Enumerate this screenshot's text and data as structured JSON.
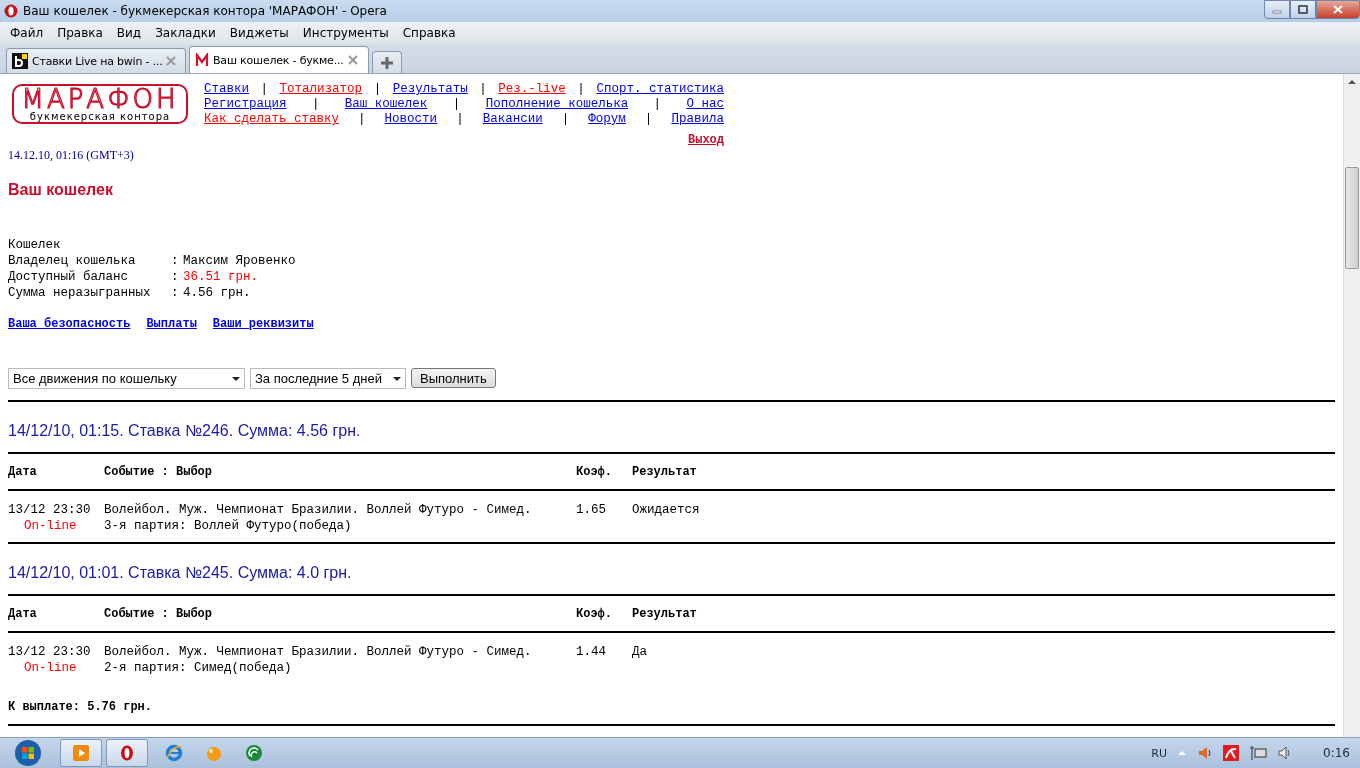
{
  "window": {
    "title": "Ваш кошелек - букмекерская контора 'МАРАФОН' - Opera"
  },
  "menu": [
    "Файл",
    "Правка",
    "Вид",
    "Закладки",
    "Виджеты",
    "Инструменты",
    "Справка"
  ],
  "tabs": [
    {
      "label": "Ставки Live на bwin - ...",
      "selected": false,
      "kind": "bwin"
    },
    {
      "label": "Ваш кошелек - букме...",
      "selected": true,
      "kind": "marathon"
    }
  ],
  "logo": {
    "name": "МАРАФОН",
    "subtitle": "букмекерская контора"
  },
  "nav_rows": [
    [
      {
        "kind": "link",
        "text": "Ставки",
        "color": "#0000ee"
      },
      {
        "kind": "separator",
        "text": "|"
      },
      {
        "kind": "link",
        "text": "Тотализатор",
        "color": "#ff0000"
      },
      {
        "kind": "separator",
        "text": "|"
      },
      {
        "kind": "link",
        "text": "Результаты",
        "color": "#0000ee"
      },
      {
        "kind": "separator",
        "text": "|"
      },
      {
        "kind": "link",
        "text": "Рез.-live",
        "color": "#ff0000"
      },
      {
        "kind": "separator",
        "text": "|"
      },
      {
        "kind": "link",
        "text": "Спорт. статистика",
        "color": "#0000ee"
      }
    ],
    [
      {
        "kind": "link",
        "text": "Регистрация",
        "color": "#0000ee"
      },
      {
        "kind": "separator",
        "text": "|"
      },
      {
        "kind": "link",
        "text": "Ваш кошелек",
        "color": "#0000ee"
      },
      {
        "kind": "separator",
        "text": "|"
      },
      {
        "kind": "link",
        "text": "Пополнение кошелька",
        "color": "#0000ee"
      },
      {
        "kind": "separator",
        "text": "|"
      },
      {
        "kind": "link",
        "text": "О нас",
        "color": "#0000ee"
      }
    ],
    [
      {
        "kind": "link",
        "text": "Как сделать ставку",
        "color": "#ff0000"
      },
      {
        "kind": "separator",
        "text": "|"
      },
      {
        "kind": "link",
        "text": "Новости",
        "color": "#0000ee"
      },
      {
        "kind": "separator",
        "text": "|"
      },
      {
        "kind": "link",
        "text": "Вакансии",
        "color": "#0000ee"
      },
      {
        "kind": "separator",
        "text": "|"
      },
      {
        "kind": "link",
        "text": "Форум",
        "color": "#0000ee"
      },
      {
        "kind": "separator",
        "text": "|"
      },
      {
        "kind": "link",
        "text": "Правила",
        "color": "#0000ee"
      }
    ]
  ],
  "logout": "Выход",
  "datetime": "14.12.10, 01:16 (GMT+3)",
  "heading": "Ваш кошелек",
  "wallet": {
    "title": "Кошелек",
    "fields": [
      {
        "label": "Владелец кошелька",
        "separator": ":",
        "value": "Максим Яровенко",
        "color": "#000000"
      },
      {
        "label": "Доступный баланс",
        "separator": ":",
        "value": "36.51 грн.",
        "color": "#ff0000"
      },
      {
        "label": "Сумма неразыгранных",
        "separator": ":",
        "value": "4.56 грн.",
        "color": "#000000"
      }
    ]
  },
  "links": [
    "Ваша безопасность",
    "Выплаты",
    "Ваши реквизиты"
  ],
  "filters": {
    "type_select": "Все движения по кошельку",
    "period_select": "За последние 5 дней",
    "submit": "Выполнить"
  },
  "bets": [
    {
      "heading": "14/12/10, 01:15. Ставка №246. Сумма: 4.56 грн.",
      "columns": [
        "Дата",
        "Событие : Выбор",
        "Коэф.",
        "Результат"
      ],
      "rows": [
        {
          "date": "13/12 23:30",
          "event": "Волейбол. Муж. Чемпионат Бразилии. Воллей Футуро - Симед.",
          "coef": "1.65",
          "result": "Ожидается",
          "mode": "On-line",
          "selection": "3-я партия: Воллей Футуро(победа)"
        }
      ]
    },
    {
      "heading": "14/12/10, 01:01. Ставка №245. Сумма: 4.0 грн.",
      "columns": [
        "Дата",
        "Событие : Выбор",
        "Коэф.",
        "Результат"
      ],
      "rows": [
        {
          "date": "13/12 23:30",
          "event": "Волейбол. Муж. Чемпионат Бразилии. Воллей Футуро - Симед.",
          "coef": "1.44",
          "result": "Да",
          "mode": "On-line",
          "selection": "2-я партия: Симед(победа)"
        }
      ],
      "payout": "К выплате: 5.76 грн."
    }
  ],
  "taskbar": {
    "language": "RU",
    "clock": "0:16"
  }
}
